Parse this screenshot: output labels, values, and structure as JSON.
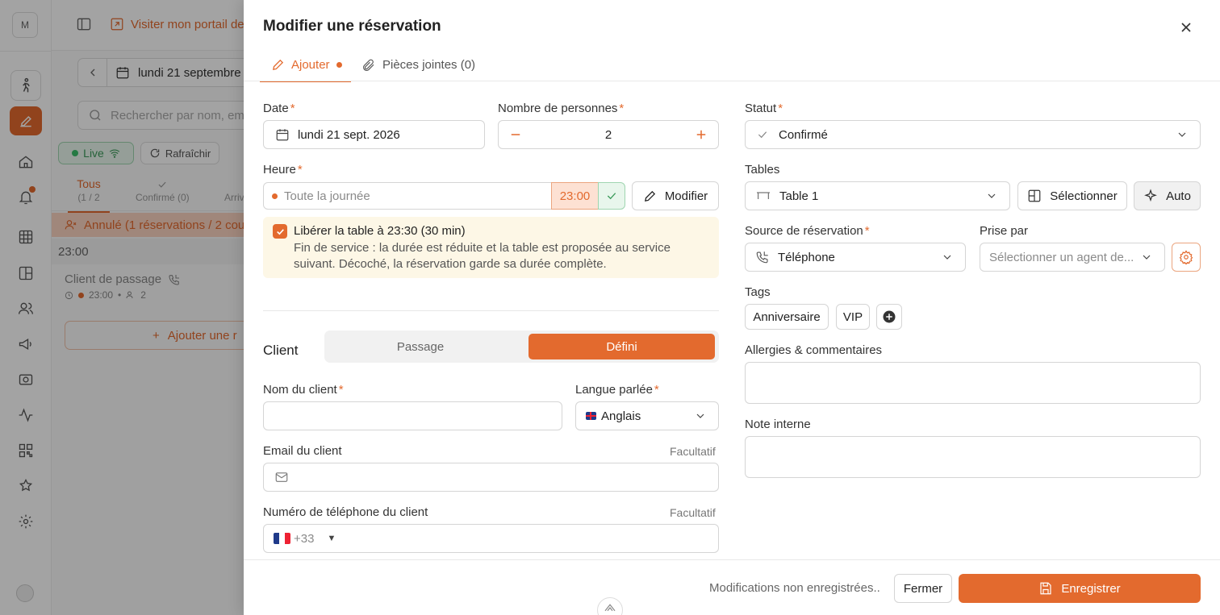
{
  "rail": {
    "logo_letter": "M",
    "items": [
      {
        "icon": "person-walking-icon"
      },
      {
        "icon": "edit-icon",
        "active": true
      },
      {
        "icon": "house-icon"
      },
      {
        "icon": "bell-icon"
      },
      {
        "icon": "grid-icon"
      },
      {
        "icon": "layout-icon"
      },
      {
        "icon": "users-icon"
      },
      {
        "icon": "megaphone-icon"
      },
      {
        "icon": "camera-icon"
      },
      {
        "icon": "activity-icon"
      },
      {
        "icon": "qr-code-icon"
      },
      {
        "icon": "star-badge-icon"
      },
      {
        "icon": "settings-icon"
      }
    ]
  },
  "background": {
    "portal_link": "Visiter mon portail de",
    "date": "lundi 21 septembre",
    "search_placeholder": "Rechercher par nom, ema",
    "live_label": "Live",
    "refresh_label": "Rafraîchir",
    "filter_tabs": [
      {
        "label": "Tous",
        "sub": "(1 / 2"
      },
      {
        "label": "Confirmé (0)",
        "sub": ""
      },
      {
        "label": "Arriv",
        "sub": ""
      }
    ],
    "cancelled_row": "Annulé (1 réservations / 2 cou",
    "time_group": "23:00",
    "reservation_name": "Client de passage",
    "reservation_time": "23:00",
    "reservation_guests": "2",
    "add_reservation": "Ajouter une r"
  },
  "modal": {
    "title": "Modifier une réservation",
    "tabs": [
      {
        "label": "Ajouter"
      },
      {
        "label": "Pièces jointes (0)"
      }
    ],
    "date": {
      "label": "Date",
      "value": "lundi 21 sept. 2026"
    },
    "guests": {
      "label": "Nombre de personnes",
      "value": "2"
    },
    "hour": {
      "label": "Heure",
      "all_day": "Toute la journée",
      "time": "23:00",
      "modify_button": "Modifier"
    },
    "release_table": {
      "title": "Libérer la table à 23:30 (30 min)",
      "description": "Fin de service : la durée est réduite et la table est proposée au service suivant. Décoché, la réservation garde sa durée complète.",
      "checked": true
    },
    "client": {
      "label": "Client",
      "options": [
        "Passage",
        "Défini"
      ],
      "selected": "Défini"
    },
    "client_name": {
      "label": "Nom du client",
      "value": ""
    },
    "language": {
      "label": "Langue parlée",
      "value": "Anglais"
    },
    "email": {
      "label": "Email du client",
      "optional": "Facultatif",
      "value": ""
    },
    "phone": {
      "label": "Numéro de téléphone du client",
      "optional": "Facultatif",
      "dial_code": "+33"
    },
    "status": {
      "label": "Statut",
      "value": "Confirmé"
    },
    "tables": {
      "label": "Tables",
      "value": "Table 1",
      "select_button": "Sélectionner",
      "auto_button": "Auto"
    },
    "source": {
      "label": "Source de réservation",
      "value": "Téléphone"
    },
    "taken_by": {
      "label": "Prise par",
      "placeholder": "Sélectionner un agent de..."
    },
    "tags": {
      "label": "Tags",
      "items": [
        "Anniversaire",
        "VIP"
      ]
    },
    "allergies": {
      "label": "Allergies & commentaires",
      "value": ""
    },
    "internal_note": {
      "label": "Note interne",
      "value": ""
    },
    "footer": {
      "unsaved": "Modifications non enregistrées..",
      "close_button": "Fermer",
      "save_button": "Enregistrer"
    }
  },
  "colors": {
    "accent": "#e36a2e",
    "success": "#3b9a5a",
    "notice_bg": "#fdf7e6"
  }
}
